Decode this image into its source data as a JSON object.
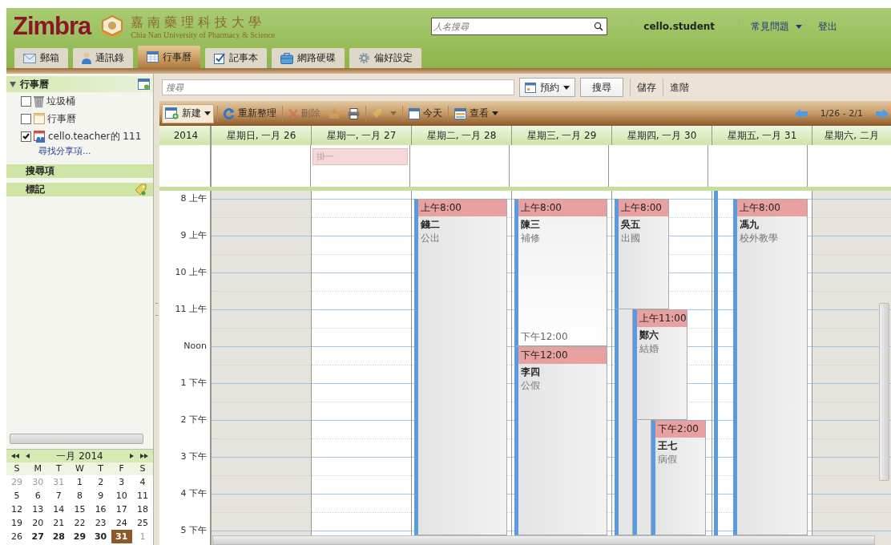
{
  "header": {
    "logo": "Zimbra",
    "school_name": "嘉南藥理科技大學",
    "school_subtitle": "Chia Nan University of Pharmacy & Science",
    "people_search": {
      "placeholder": "人名搜尋"
    },
    "user": "cello.student",
    "help": "常見問題",
    "logout": "登出"
  },
  "tabs": [
    {
      "label": "郵箱",
      "kind": "mail",
      "selected": false
    },
    {
      "label": "通訊錄",
      "kind": "contacts",
      "selected": false
    },
    {
      "label": "行事曆",
      "kind": "calendar",
      "selected": true
    },
    {
      "label": "記事本",
      "kind": "tasks",
      "selected": false
    },
    {
      "label": "網路硬碟",
      "kind": "briefcase",
      "selected": false
    },
    {
      "label": "偏好設定",
      "kind": "preferences",
      "selected": false
    }
  ],
  "sidebar": {
    "calendars_header": "行事曆",
    "expanded": true,
    "calendars": [
      {
        "name": "垃圾桶",
        "kind": "trash",
        "checked": false
      },
      {
        "name": "行事曆",
        "kind": "calendar",
        "checked": false
      },
      {
        "name": "cello.teacher的 111",
        "kind": "shared",
        "checked": true
      }
    ],
    "find_shares": "尋找分享項...",
    "searches": "搜尋項",
    "tags": "標記"
  },
  "mini_calendar": {
    "title": "一月 2014",
    "weekdays": [
      "S",
      "M",
      "T",
      "W",
      "T",
      "F",
      "S"
    ],
    "weeks": [
      [
        {
          "label": "29",
          "muted": true,
          "bold": false,
          "selected": false
        },
        {
          "label": "30",
          "muted": true,
          "bold": false,
          "selected": false
        },
        {
          "label": "31",
          "muted": true,
          "bold": false,
          "selected": false
        },
        {
          "label": "1",
          "muted": false,
          "bold": false,
          "selected": false
        },
        {
          "label": "2",
          "muted": false,
          "bold": false,
          "selected": false
        },
        {
          "label": "3",
          "muted": false,
          "bold": false,
          "selected": false
        },
        {
          "label": "4",
          "muted": false,
          "bold": false,
          "selected": false
        }
      ],
      [
        {
          "label": "5",
          "muted": false,
          "bold": false,
          "selected": false
        },
        {
          "label": "6",
          "muted": false,
          "bold": false,
          "selected": false
        },
        {
          "label": "7",
          "muted": false,
          "bold": false,
          "selected": false
        },
        {
          "label": "8",
          "muted": false,
          "bold": false,
          "selected": false
        },
        {
          "label": "9",
          "muted": false,
          "bold": false,
          "selected": false
        },
        {
          "label": "10",
          "muted": false,
          "bold": false,
          "selected": false
        },
        {
          "label": "11",
          "muted": false,
          "bold": false,
          "selected": false
        }
      ],
      [
        {
          "label": "12",
          "muted": false,
          "bold": false,
          "selected": false
        },
        {
          "label": "13",
          "muted": false,
          "bold": false,
          "selected": false
        },
        {
          "label": "14",
          "muted": false,
          "bold": false,
          "selected": false
        },
        {
          "label": "15",
          "muted": false,
          "bold": false,
          "selected": false
        },
        {
          "label": "16",
          "muted": false,
          "bold": false,
          "selected": false
        },
        {
          "label": "17",
          "muted": false,
          "bold": false,
          "selected": false
        },
        {
          "label": "18",
          "muted": false,
          "bold": false,
          "selected": false
        }
      ],
      [
        {
          "label": "19",
          "muted": false,
          "bold": false,
          "selected": false
        },
        {
          "label": "20",
          "muted": false,
          "bold": false,
          "selected": false
        },
        {
          "label": "21",
          "muted": false,
          "bold": false,
          "selected": false
        },
        {
          "label": "22",
          "muted": false,
          "bold": false,
          "selected": false
        },
        {
          "label": "23",
          "muted": false,
          "bold": false,
          "selected": false
        },
        {
          "label": "24",
          "muted": false,
          "bold": false,
          "selected": false
        },
        {
          "label": "25",
          "muted": false,
          "bold": false,
          "selected": false
        }
      ],
      [
        {
          "label": "26",
          "muted": false,
          "bold": false,
          "selected": false
        },
        {
          "label": "27",
          "muted": false,
          "bold": true,
          "selected": false
        },
        {
          "label": "28",
          "muted": false,
          "bold": true,
          "selected": false
        },
        {
          "label": "29",
          "muted": false,
          "bold": true,
          "selected": false
        },
        {
          "label": "30",
          "muted": false,
          "bold": true,
          "selected": false
        },
        {
          "label": "31",
          "muted": false,
          "bold": true,
          "selected": true
        },
        {
          "label": "1",
          "muted": true,
          "bold": false,
          "selected": false
        }
      ]
    ]
  },
  "search_bar": {
    "placeholder": "搜尋",
    "type": "預約",
    "search": "搜尋",
    "save": "儲存",
    "advanced": "進階"
  },
  "toolbar": {
    "items": [
      {
        "kind": "new",
        "label": "新建",
        "disabled": false
      },
      {
        "kind": "refresh",
        "label": "重新整理",
        "disabled": false
      },
      {
        "kind": "delete",
        "label": "刪除",
        "disabled": true
      },
      {
        "kind": "move",
        "disabled": true
      },
      {
        "kind": "print",
        "disabled": false
      },
      {
        "kind": "tag",
        "disabled": true
      },
      {
        "kind": "more",
        "disabled": true
      },
      {
        "kind": "today",
        "label": "今天",
        "disabled": false
      },
      {
        "kind": "view",
        "label": "查看",
        "disabled": false
      }
    ],
    "range": "1/26 - 2/1"
  },
  "calendar": {
    "year": "2014",
    "hours": [
      "8 上午",
      "9 上午",
      "10 上午",
      "11 上午",
      "Noon",
      "1 下午",
      "2 下午",
      "3 下午",
      "4 下午",
      "5 下午"
    ],
    "days": [
      {
        "label": "星期日, 一月 26",
        "weekend": true,
        "today": false
      },
      {
        "label": "星期一, 一月 27",
        "weekend": false,
        "today": false,
        "all_day": [
          {
            "title": "掛一"
          }
        ]
      },
      {
        "label": "星期二, 一月 28",
        "weekend": false,
        "today": false,
        "events": [
          {
            "start": "上午8:00",
            "title": "錢二",
            "location": "公出"
          }
        ]
      },
      {
        "label": "星期三, 一月 29",
        "weekend": false,
        "today": false,
        "events": [
          {
            "start": "上午8:00",
            "title": "陳三",
            "location": "補修",
            "end": "下午12:00"
          },
          {
            "start": "下午12:00",
            "title": "李四",
            "location": "公假"
          }
        ]
      },
      {
        "label": "星期四, 一月 30",
        "weekend": false,
        "today": false,
        "events": [
          {
            "start": "上午8:00",
            "title": "吳五",
            "location": "出國"
          },
          {
            "start": "上午11:00",
            "title": "鄭六",
            "location": "結婚"
          },
          {
            "start": "下午2:00",
            "title": "王七",
            "location": "病假"
          }
        ]
      },
      {
        "label": "星期五, 一月 31",
        "weekend": false,
        "today": true,
        "events": [
          {
            "start": "上午8:00",
            "title": "馮九",
            "location": "校外教學"
          }
        ]
      },
      {
        "label": "星期六, 二月",
        "weekend": true,
        "today": false
      }
    ]
  }
}
